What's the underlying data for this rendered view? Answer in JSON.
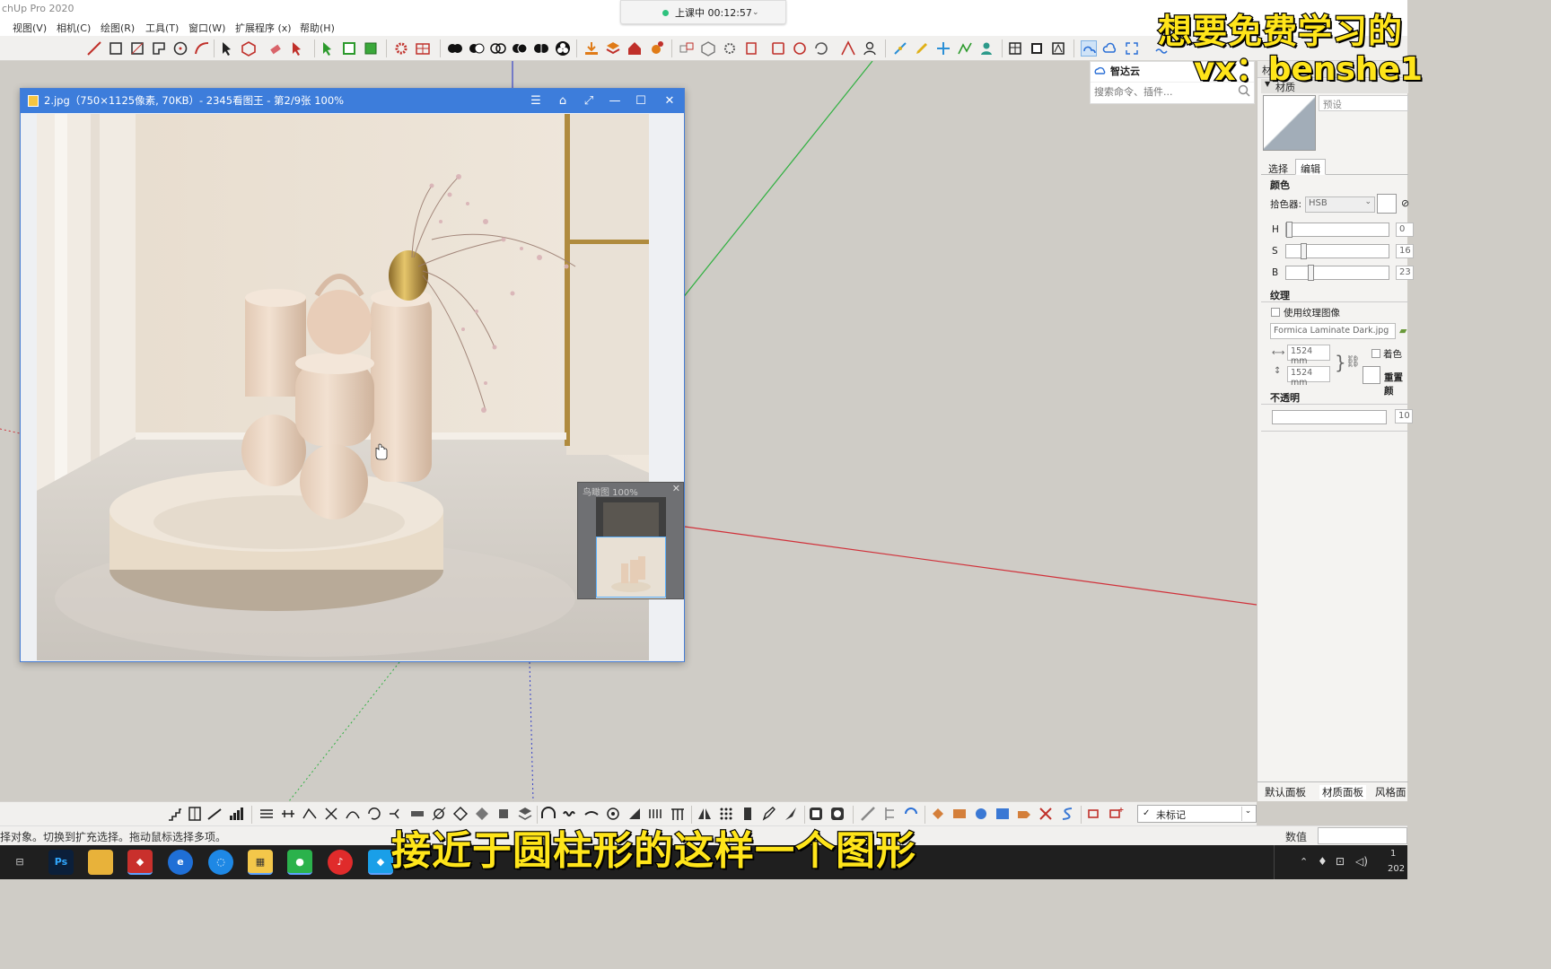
{
  "app": {
    "title": "chUp Pro 2020",
    "menu": [
      "视图(V)",
      "相机(C)",
      "绘图(R)",
      "工具(T)",
      "窗口(W)",
      "扩展程序 (x)",
      "帮助(H)"
    ]
  },
  "recording": {
    "status": "上课中 00:12:57"
  },
  "image_viewer": {
    "title": "2.jpg（750×1125像素, 70KB）- 2345看图王 - 第2/9张 100%",
    "navigator_title": "鸟瞰图 100%",
    "buttons": {
      "menu": "☰",
      "skin": "⌂",
      "fullscreen": "⤢",
      "minimize": "—",
      "maximize": "☐",
      "close": "✕"
    }
  },
  "cloud_panel": {
    "title": "智达云",
    "search_placeholder": "搜索命令、插件..."
  },
  "materials": {
    "tray_title": "材",
    "section": "材质",
    "preset_placeholder": "预设",
    "tabs": [
      "选择",
      "编辑"
    ],
    "active_tab": "编辑",
    "color_heading": "颜色",
    "picker_label": "拾色器:",
    "picker_value": "HSB",
    "channels": [
      {
        "label": "H",
        "value": "0"
      },
      {
        "label": "S",
        "value": "16"
      },
      {
        "label": "B",
        "value": "23"
      }
    ],
    "texture_heading": "纹理",
    "use_texture_label": "使用纹理图像",
    "texture_file": "Formica Laminate Dark.jpg",
    "width": "1524 mm",
    "height": "1524 mm",
    "colorize_label": "着色",
    "reset_label": "重置颜",
    "opacity_heading": "不透明",
    "opacity_value": "10",
    "tray_tabs": [
      "默认面板",
      "材质面板",
      "风格面"
    ]
  },
  "layer_select": {
    "value": "未标记"
  },
  "status": {
    "hint": "择对象。切换到扩充选择。拖动鼠标选择多项。",
    "measure_label": "数值"
  },
  "overlay": {
    "line1": "想要免费学习的",
    "line2": "vx：benshe1",
    "caption": "接近于圆柱形的这样一个图形"
  },
  "taskbar": {
    "apps": [
      "任务视图",
      "Ps",
      "文件",
      "SketchUp",
      "浏览器",
      "Edge",
      "看图王",
      "微信",
      "网易云",
      "云盘"
    ],
    "clock_1": "1",
    "clock_2": "202"
  },
  "colors": {
    "viewer_titlebar": "#3d7ddb",
    "overlay_text": "#ffe51a",
    "viewport_bg": "#cfccc6",
    "axis_red": "#d0313a",
    "axis_green": "#2fb040",
    "axis_blue": "#3742c8"
  }
}
